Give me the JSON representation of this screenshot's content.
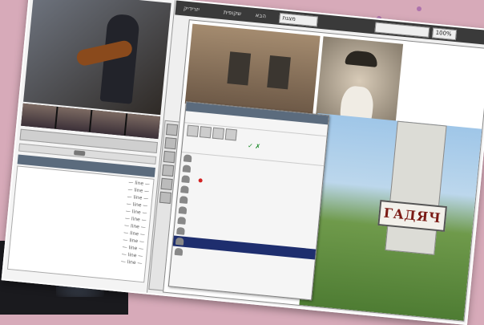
{
  "chat_lines": [
    "— line —",
    "— line —",
    "— line —",
    "— line —",
    "— line —",
    "— line —",
    "— line —",
    "— line —",
    "— line —",
    "— line —",
    "— line —",
    "— line —"
  ],
  "topbar": {
    "tab1": "יזרידיק",
    "tab2": "שקופית",
    "tab3": "הבא",
    "select1": "מצגת",
    "select2": "",
    "zoom": "100%"
  },
  "ctrl_label": "",
  "chat_header": "",
  "sign_text": "ГАДЯЧ",
  "users": {
    "header": "",
    "me": "",
    "sub": "",
    "rows": [
      "",
      "",
      "",
      "",
      "",
      "",
      "",
      "",
      "",
      ""
    ]
  }
}
